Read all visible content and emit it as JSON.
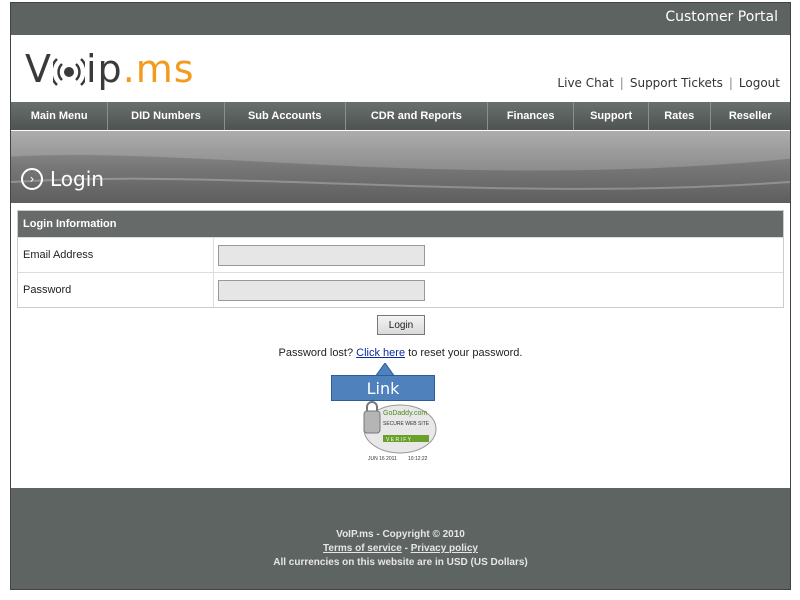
{
  "header": {
    "portal_title": "Customer Portal",
    "logo": {
      "part1": "V",
      "part2": "ip",
      "dot_ms": ".ms"
    },
    "links": [
      "Live Chat",
      "Support Tickets",
      "Logout"
    ]
  },
  "nav": {
    "items": [
      "Main Menu",
      "DID Numbers",
      "Sub Accounts",
      "CDR and Reports",
      "Finances",
      "Support",
      "Rates",
      "Reseller"
    ]
  },
  "banner": {
    "title": "Login"
  },
  "form": {
    "header": "Login Information",
    "email_label": "Email Address",
    "email_value": "",
    "password_label": "Password",
    "password_value": "",
    "login_button": "Login"
  },
  "password_lost": {
    "prefix": "Password lost?",
    "link": "Click here",
    "suffix": "to reset your password."
  },
  "callout": {
    "label": "Link"
  },
  "badge": {
    "brand": "GoDaddy.com",
    "line1": "SECURE WEB SITE",
    "verify": "V E R I F Y",
    "date": "JUN 16 2011",
    "time": "10:12:22"
  },
  "footer": {
    "copyright": "VoIP.ms - Copyright © 2010",
    "terms": "Terms of service",
    "separator": "-",
    "privacy": "Privacy policy",
    "currency_note": "All currencies on this website are in USD (US Dollars)"
  },
  "colors": {
    "topbar": "#5c6360",
    "accent_orange": "#f39b1e",
    "callout_blue": "#4f81bd",
    "link_blue": "#0a2a9e"
  }
}
